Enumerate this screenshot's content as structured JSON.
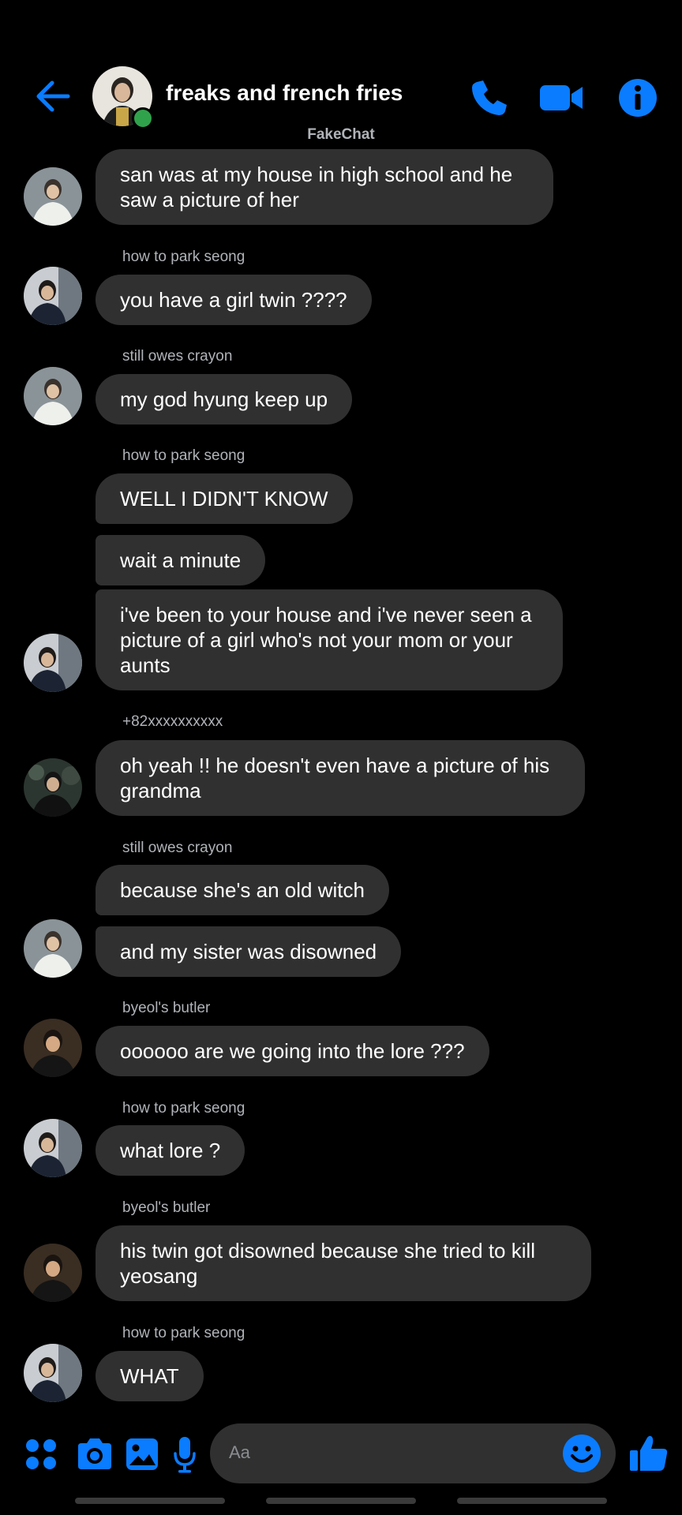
{
  "header": {
    "title": "freaks and french fries"
  },
  "app_label": "FakeChat",
  "colors": {
    "accent": "#0a7cff",
    "bubble": "#303030",
    "background": "#000000",
    "secondary_text": "#b0b3b8",
    "online": "#31a24c"
  },
  "icons": {
    "back": "arrow-left-icon",
    "call": "phone-icon",
    "video": "video-camera-icon",
    "info": "info-icon",
    "apps": "four-dots-icon",
    "camera": "camera-icon",
    "gallery": "image-icon",
    "mic": "microphone-icon",
    "emoji": "smiley-icon",
    "like": "thumbs-up-icon"
  },
  "messages": [
    {
      "sender": "",
      "text": "san was at my house in high school and he saw a picture of her"
    },
    {
      "sender": "how to park seong",
      "text": "you have a girl twin ????"
    },
    {
      "sender": "still owes crayon",
      "text": "my god hyung keep up"
    },
    {
      "sender": "how to park seong",
      "text": "WELL I DIDN'T KNOW"
    },
    {
      "sender": "",
      "text": "wait a minute"
    },
    {
      "sender": "",
      "text": "i've been to your house and i've never seen a picture of a girl who's not your mom or your aunts"
    },
    {
      "sender": "+82xxxxxxxxxx",
      "text": "oh yeah !! he doesn't even have a picture of his grandma"
    },
    {
      "sender": "still owes crayon",
      "text": "because she's an old witch"
    },
    {
      "sender": "",
      "text": "and my sister was disowned"
    },
    {
      "sender": "byeol's butler",
      "text": "oooooo are we going into the lore ???"
    },
    {
      "sender": "how to park seong",
      "text": "what lore ?"
    },
    {
      "sender": "byeol's butler",
      "text": "his twin got disowned because she tried to kill yeosang"
    },
    {
      "sender": "how to park seong",
      "text": "WHAT"
    }
  ],
  "composer": {
    "placeholder": "Aa"
  }
}
